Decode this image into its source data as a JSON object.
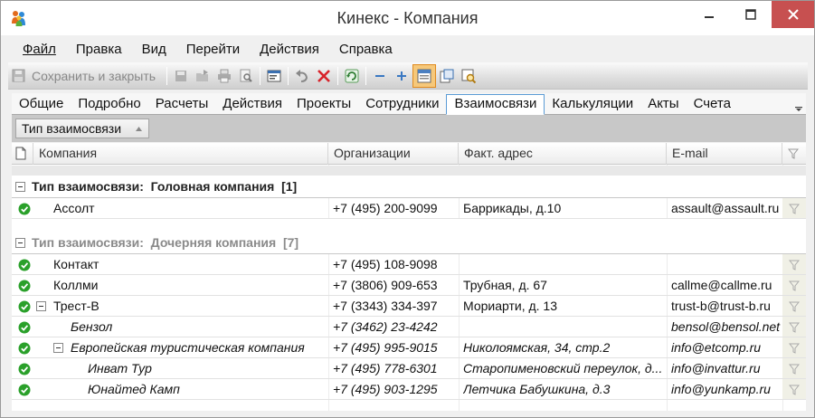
{
  "window": {
    "title": "Кинекс - Компания"
  },
  "menu": [
    {
      "label": "Файл"
    },
    {
      "label": "Правка"
    },
    {
      "label": "Вид"
    },
    {
      "label": "Перейти"
    },
    {
      "label": "Действия"
    },
    {
      "label": "Справка"
    }
  ],
  "toolbar": {
    "save_close_label": "Сохранить и закрыть"
  },
  "tabs": [
    {
      "label": "Общие"
    },
    {
      "label": "Подробно"
    },
    {
      "label": "Расчеты"
    },
    {
      "label": "Действия"
    },
    {
      "label": "Проекты"
    },
    {
      "label": "Сотрудники"
    },
    {
      "label": "Взаимосвязи",
      "active": true
    },
    {
      "label": "Калькуляции"
    },
    {
      "label": "Акты"
    },
    {
      "label": "Счета"
    }
  ],
  "group_panel": {
    "chip_label": "Тип взаимосвязи"
  },
  "grid": {
    "columns": [
      {
        "label": "Компания"
      },
      {
        "label": "Организации"
      },
      {
        "label": "Факт. адрес"
      },
      {
        "label": "E-mail"
      }
    ],
    "groups": [
      {
        "prefix": "Тип взаимосвязи:",
        "value": "Головная компания",
        "count": "[1]"
      },
      {
        "prefix": "Тип взаимосвязи:",
        "value": "Дочерняя компания",
        "count": "[7]"
      }
    ],
    "rows": [
      {
        "company": "Ассолт",
        "phone": "+7 (495) 200-9099",
        "address": "Баррикады, д.10",
        "email": "assault@assault.ru"
      },
      {
        "company": "Контакт",
        "phone": "+7 (495) 108-9098",
        "address": "",
        "email": ""
      },
      {
        "company": "Коллми",
        "phone": "+7 (3806) 909-653",
        "address": "Трубная, д. 67",
        "email": "callme@callme.ru"
      },
      {
        "company": "Трест-В",
        "phone": "+7 (3343) 334-397",
        "address": "Мориарти, д. 13",
        "email": "trust-b@trust-b.ru"
      },
      {
        "company": "Бензол",
        "phone": "+7 (3462) 23-4242",
        "address": "",
        "email": "bensol@bensol.net"
      },
      {
        "company": "Европейская туристическая компания",
        "phone": "+7 (495) 995-9015",
        "address": "Николоямская, 34, стр.2",
        "email": "info@etcomp.ru"
      },
      {
        "company": "Инват Тур",
        "phone": "+7 (495) 778-6301",
        "address": "Старопименовский переулок, д...",
        "email": "info@invattur.ru"
      },
      {
        "company": "Юнайтед Камп",
        "phone": "+7 (495) 903-1295",
        "address": "Летчика Бабушкина, д.3",
        "email": "info@yunkamp.ru"
      }
    ]
  },
  "colors": {
    "close_button": "#c75050",
    "active_tab_border": "#5b9bd5",
    "status_ok": "#2aa02a"
  },
  "icons": {
    "app": "people-icon",
    "status": "check-circle-icon"
  }
}
